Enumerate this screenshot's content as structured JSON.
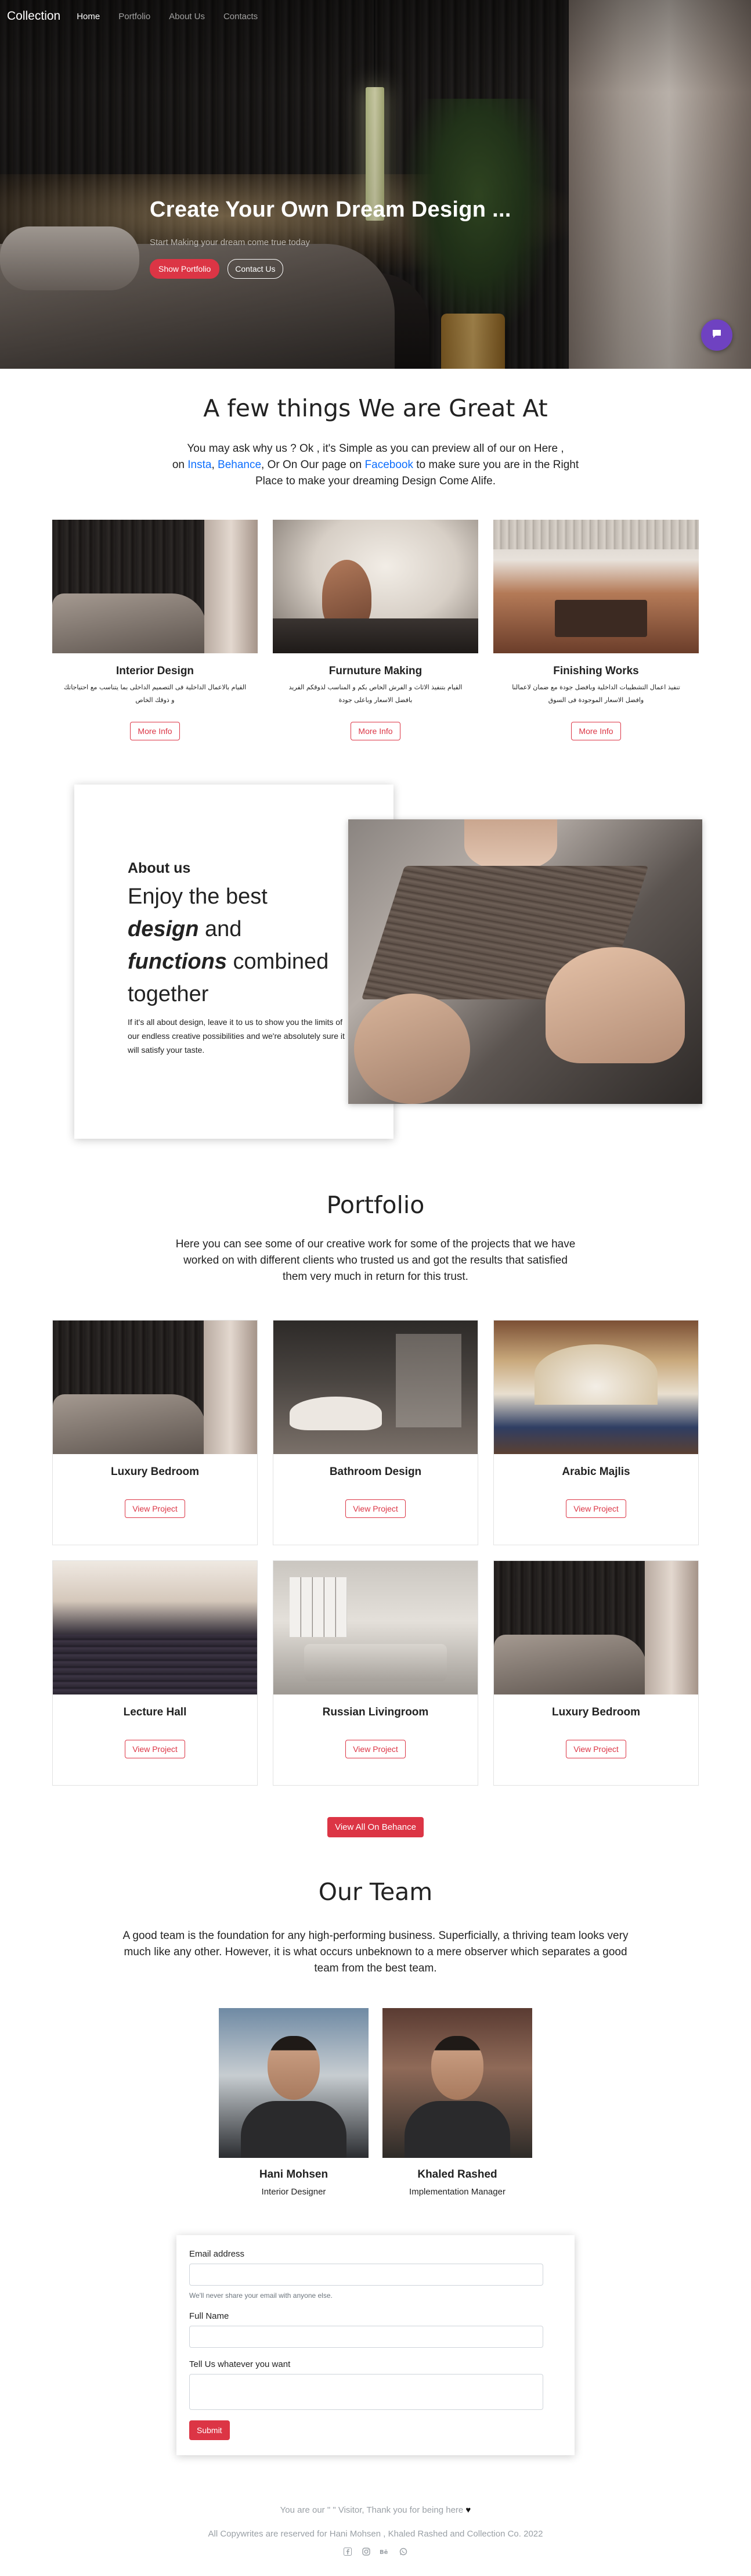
{
  "nav": {
    "brand": "Collection",
    "links": [
      "Home",
      "Portfolio",
      "About Us",
      "Contacts"
    ]
  },
  "hero": {
    "title": "Create Your Own Dream Design ...",
    "subtitle": "Start Making your dream come true today",
    "show_portfolio": "Show Portfolio",
    "contact_us": "Contact Us",
    "chat_icon": "chat-bubble-icon"
  },
  "services": {
    "title": "A few things We are Great At",
    "lead_1": "You may ask why us ? Ok , it's Simple as you can preview all of our on Here ,",
    "lead_on": "on ",
    "insta": "Insta",
    "comma": ", ",
    "behance": "Behance",
    "lead_mid": ", Or On Our page on ",
    "facebook": "Facebook",
    "lead_2": " to make sure you are in the Right Place to make your dreaming Design Come Alife.",
    "items": [
      {
        "title": "Interior Design",
        "text": "القيام بالاعمال الداخلية فى التصميم الداخلى بما يتناسب مع احتياجاتك و ذوقك الخاص",
        "button": "More Info"
      },
      {
        "title": "Furnuture Making",
        "text": "القيام بتنفيذ الاثاث و الفرش الخاص بكم و المناسب لذوقكم الفريد بافضل الاسعار وباعلى جودة",
        "button": "More Info"
      },
      {
        "title": "Finishing Works",
        "text": "تنفيذ اعمال التشطيبات الداخلية وبافضل جودة مع ضمان لاعمالنا وافضل الاسعار الموجودة فى السوق",
        "button": "More Info"
      }
    ]
  },
  "about": {
    "label": "About us",
    "head_1": "Enjoy the best",
    "head_design": "design",
    "head_and": " and",
    "head_functions": "functions",
    "head_combined": " combined together",
    "body": "If it's all about design, leave it to us to show you the limits of our endless creative possibilities and we're absolutely sure it will satisfy your taste."
  },
  "portfolio": {
    "title": "Portfolio",
    "lead": "Here you can see some of our creative work for some of the projects that we have worked on with different clients who trusted us and got the results that satisfied them very much in return for this trust.",
    "projects": [
      {
        "title": "Luxury Bedroom",
        "button": "View Project"
      },
      {
        "title": "Bathroom Design",
        "button": "View Project"
      },
      {
        "title": "Arabic Majlis",
        "button": "View Project"
      },
      {
        "title": "Lecture Hall",
        "button": "View Project"
      },
      {
        "title": "Russian Livingroom",
        "button": "View Project"
      },
      {
        "title": "Luxury Bedroom",
        "button": "View Project"
      }
    ],
    "view_all": "View All On Behance"
  },
  "team": {
    "title": "Our Team",
    "lead": "A good team is the foundation for any high-performing business. Superficially, a thriving team looks very much like any other. However, it is what occurs unbeknown to a mere observer which separates a good team from the best team.",
    "members": [
      {
        "name": "Hani Mohsen",
        "role": "Interior Designer"
      },
      {
        "name": "Khaled Rashed",
        "role": "Implementation Manager"
      }
    ]
  },
  "form": {
    "email_label": "Email address",
    "email_value": "",
    "email_help": "We'll never share your email with anyone else.",
    "name_label": "Full Name",
    "name_value": "",
    "message_label": "Tell Us whatever you want",
    "message_value": "",
    "submit": "Submit"
  },
  "footer": {
    "visitor_prefix": "You are our \" \" Visitor, Thank you for being here",
    "heart": "♥",
    "copyright": "All Copywrites are reserved for Hani Mohsen , Khaled Rashed and Collection Co. 2022",
    "social_icons": [
      "facebook-icon",
      "instagram-icon",
      "behance-icon",
      "whatsapp-icon"
    ]
  }
}
